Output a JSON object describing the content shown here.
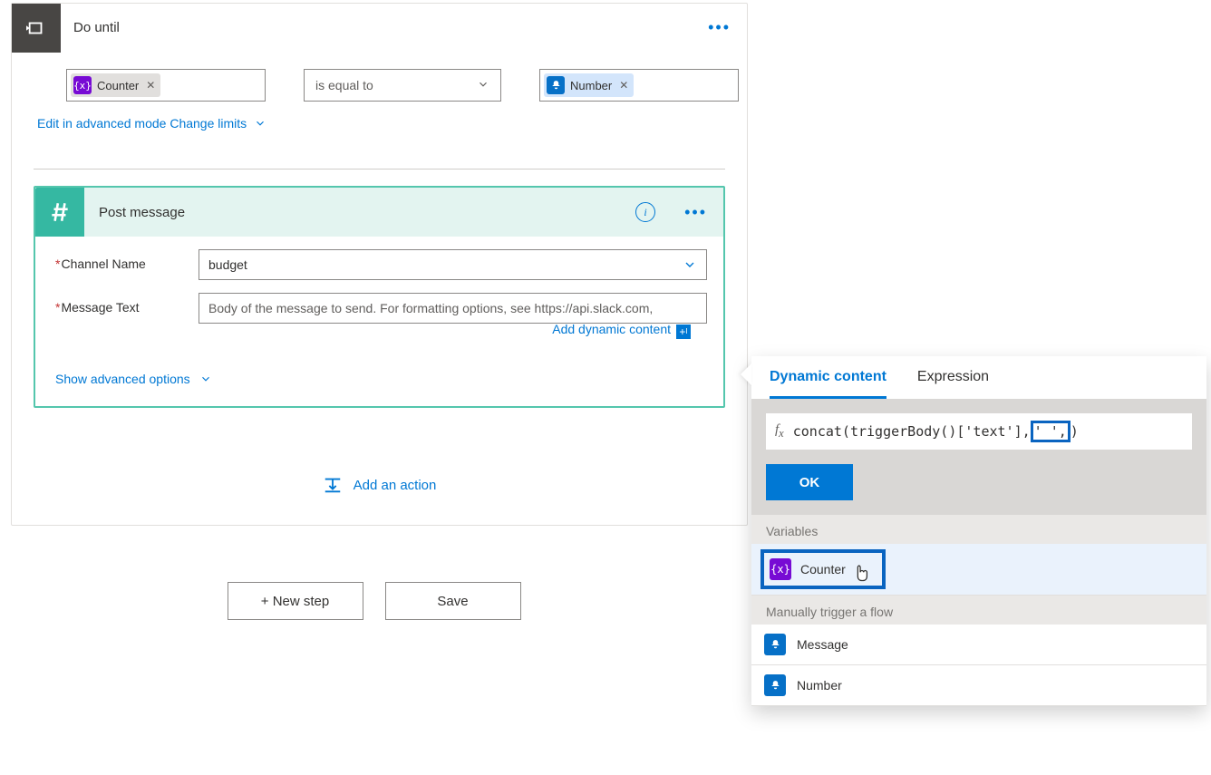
{
  "do_until": {
    "title": "Do until",
    "left_token": "Counter",
    "operator": "is equal to",
    "right_token": "Number",
    "edit_advanced": "Edit in advanced mode",
    "change_limits": "Change limits"
  },
  "post_message": {
    "title": "Post message",
    "channel_label": "Channel Name",
    "channel_value": "budget",
    "message_label": "Message Text",
    "message_placeholder": "Body of the message to send. For formatting options, see https://api.slack.com,",
    "add_dynamic": "Add dynamic content",
    "show_advanced": "Show advanced options"
  },
  "add_action": "Add an action",
  "buttons": {
    "new_step": "+ New step",
    "save": "Save"
  },
  "popover": {
    "tab_dynamic": "Dynamic content",
    "tab_expression": "Expression",
    "expr_before": "concat(triggerBody()['text'],",
    "expr_mid": "' ',",
    "expr_after": ")",
    "ok": "OK",
    "sec_variables": "Variables",
    "counter": "Counter",
    "sec_trigger": "Manually trigger a flow",
    "item_message": "Message",
    "item_number": "Number"
  }
}
